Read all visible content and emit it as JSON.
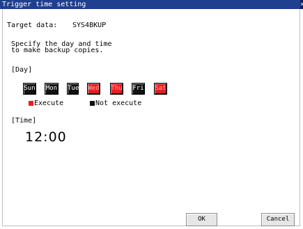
{
  "title": "Trigger time setting",
  "target": {
    "label": "Target data:",
    "value": "SYS4BKUP"
  },
  "instruction": [
    "Specify the day and time",
    "to make backup copies."
  ],
  "day_heading": "[Day]",
  "days": [
    {
      "label": "Sun",
      "execute": false
    },
    {
      "label": "Mon",
      "execute": false
    },
    {
      "label": "Tue",
      "execute": false
    },
    {
      "label": "Wed",
      "execute": true
    },
    {
      "label": "Thu",
      "execute": true
    },
    {
      "label": "Fri",
      "execute": false
    },
    {
      "label": "Sat",
      "execute": true
    }
  ],
  "legend": {
    "execute": "Execute",
    "not_execute": "Not execute"
  },
  "colors": {
    "execute": "#ee1c1c",
    "not_execute": "#111111",
    "titlebar": "#1f3f8f"
  },
  "time_heading": "[Time]",
  "time_value": "12:00",
  "buttons": {
    "ok": "OK",
    "cancel": "Cancel"
  },
  "icons": {
    "close": "close-icon"
  }
}
